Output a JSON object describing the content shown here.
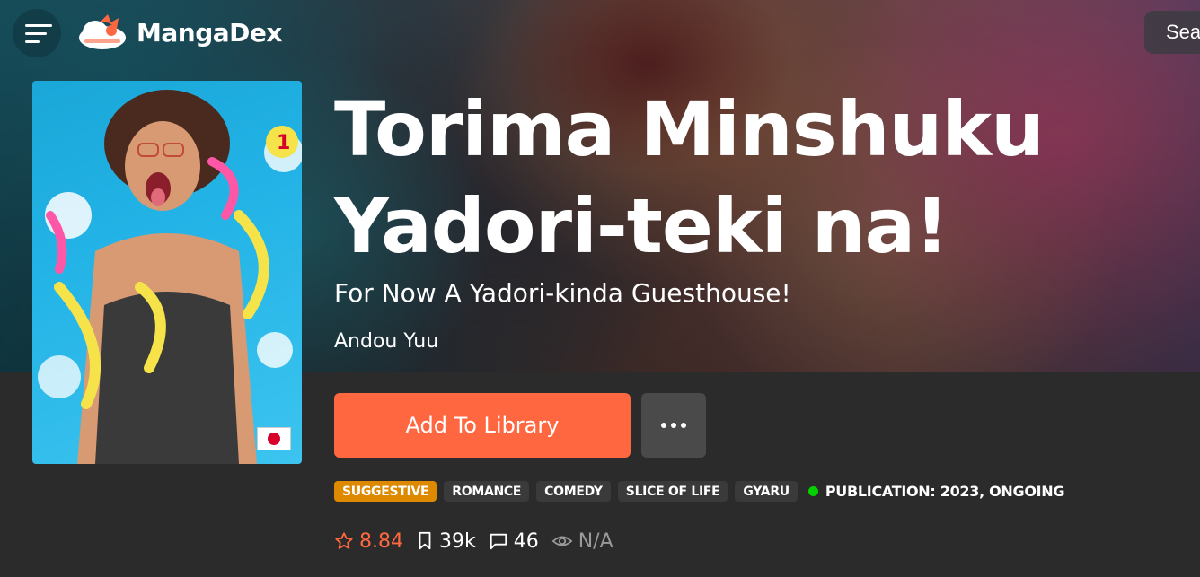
{
  "nav": {
    "logo_text": "MangaDex",
    "search_placeholder": "Sea"
  },
  "manga": {
    "title_line1": "Torima Minshuku",
    "title_line2": "Yadori-teki na!",
    "alt_title": "For Now A Yadori-kinda Guesthouse!",
    "author": "Andou Yuu",
    "language_flag": "jp-flag-icon"
  },
  "actions": {
    "add_label": "Add To Library",
    "more_icon": "ellipsis-icon"
  },
  "tags": [
    {
      "label": "SUGGESTIVE",
      "color": "#dd8a00"
    },
    {
      "label": "ROMANCE"
    },
    {
      "label": "COMEDY"
    },
    {
      "label": "SLICE OF LIFE"
    },
    {
      "label": "GYARU"
    }
  ],
  "publication": {
    "status_color": "#04d000",
    "text": "PUBLICATION: 2023, ONGOING"
  },
  "stats": {
    "rating": "8.84",
    "follows": "39k",
    "comments": "46",
    "views": "N/A"
  },
  "colors": {
    "accent": "#ff6740",
    "background": "#2b2b2b"
  }
}
